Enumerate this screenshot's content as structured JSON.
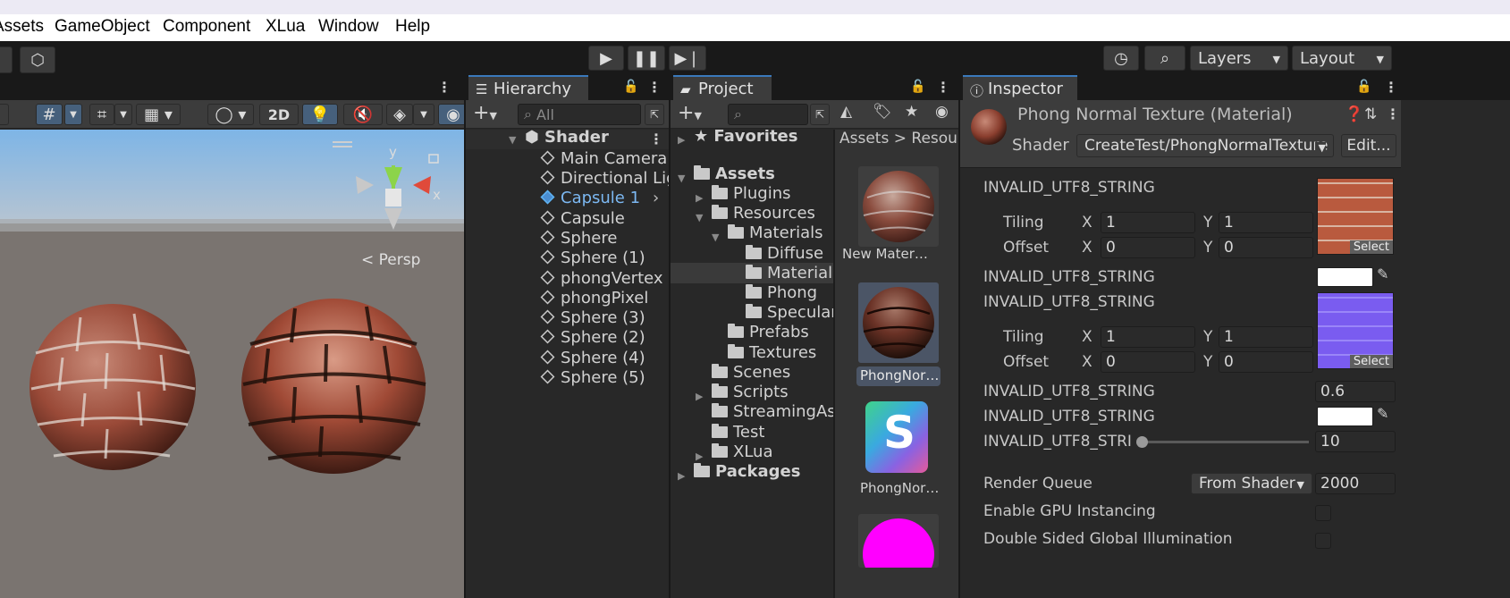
{
  "menu": [
    "Assets",
    "GameObject",
    "Component",
    "XLua",
    "Window",
    "Help"
  ],
  "toolbar": {
    "layers_label": "Layers",
    "layout_label": "Layout"
  },
  "scene": {
    "btn_2d": "2D",
    "gizmo_y": "y",
    "gizmo_x": "x",
    "persp_label": "< Persp"
  },
  "hierarchy": {
    "tab": "Hierarchy",
    "search_placeholder": "All",
    "root": "Shader",
    "items": [
      "Main Camera",
      "Directional Lig",
      "Capsule 1",
      "Capsule",
      "Sphere",
      "Sphere (1)",
      "phongVertex",
      "phongPixel",
      "Sphere (3)",
      "Sphere (2)",
      "Sphere (4)",
      "Sphere (5)"
    ]
  },
  "project": {
    "tab": "Project",
    "favorites": "Favorites",
    "assets": "Assets",
    "tree": [
      "Plugins",
      "Resources",
      "Materials",
      "Diffuse",
      "Materials",
      "Phong",
      "Specular",
      "Prefabs",
      "Textures",
      "Scenes",
      "Scripts",
      "StreamingAsse",
      "Test",
      "XLua"
    ],
    "packages": "Packages",
    "breadcrumb_assets": "Assets",
    "breadcrumb_sep": ">",
    "breadcrumb_res": "Resour",
    "thumbs": [
      "New Mater…",
      "PhongNor…",
      "PhongNor…"
    ],
    "shader_letter": "S"
  },
  "inspector": {
    "tab": "Inspector",
    "title": "Phong Normal Texture (Material)",
    "shader_label": "Shader",
    "shader_value": "CreateTest/PhongNormalTexture",
    "edit_label": "Edit...",
    "props": [
      "INVALID_UTF8_STRING",
      "INVALID_UTF8_STRING",
      "INVALID_UTF8_STRING",
      "INVALID_UTF8_STRING",
      "INVALID_UTF8_STRING",
      "INVALID_UTF8_STRI"
    ],
    "tiling": "Tiling",
    "offset": "Offset",
    "x": "X",
    "y": "Y",
    "tex1": {
      "tx": "1",
      "ty": "1",
      "ox": "0",
      "oy": "0"
    },
    "tex2": {
      "tx": "1",
      "ty": "1",
      "ox": "0",
      "oy": "0"
    },
    "select": "Select",
    "float_value": "0.6",
    "slider_value": "10",
    "slider_fraction": 0.0,
    "render_queue_label": "Render Queue",
    "render_queue_mode": "From Shader",
    "render_queue_value": "2000",
    "gpu_instancing": "Enable GPU Instancing",
    "double_sided": "Double Sided Global Illumination"
  },
  "colors": {
    "accent": "#3a79bb",
    "selected_text": "#7cb8f2",
    "magenta": "#ff00ff"
  }
}
